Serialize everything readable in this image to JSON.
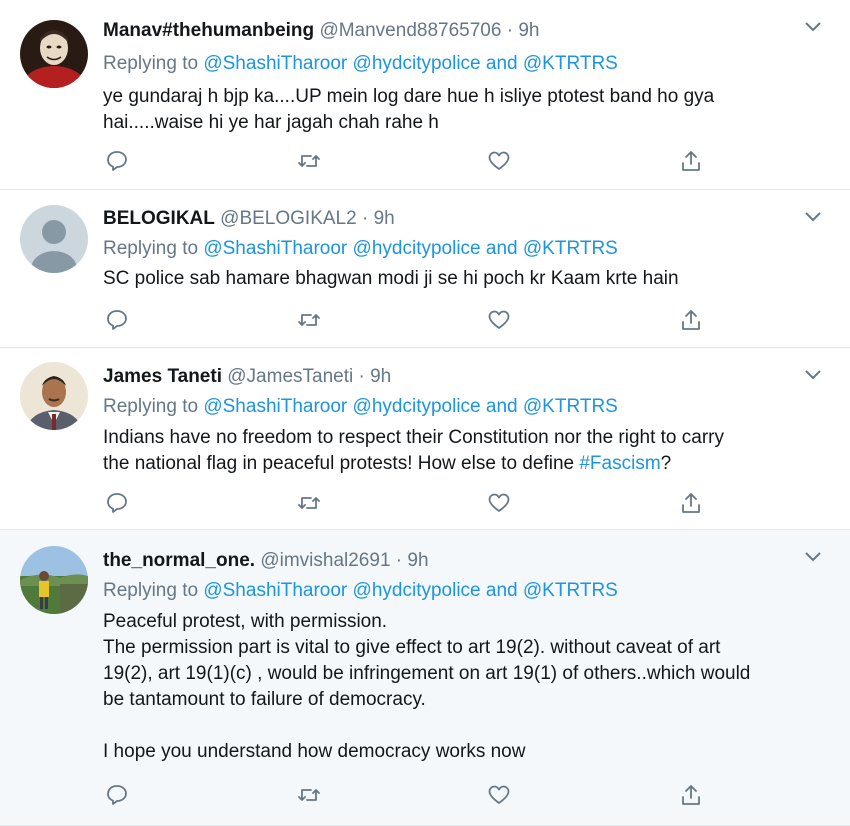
{
  "tweets": [
    {
      "name": "Manav#thehumanbeing",
      "handle": "@Manvend88765706",
      "sep": "·",
      "time": "9h",
      "replying_prefix": "Replying to",
      "mention1": "@ShashiTharoor",
      "mention2": "@hydcitypolice",
      "and": "and",
      "mention3": "@KTRTRS",
      "lines": [
        "ye gundaraj h bjp ka....UP mein log dare hue h isliye ptotest band ho gya",
        "hai.....waise hi ye har jagah chah rahe h"
      ],
      "avatar_icon": "masked-figure-avatar"
    },
    {
      "name": "BELOGIKAL",
      "handle": "@BELOGIKAL2",
      "sep": "·",
      "time": "9h",
      "replying_prefix": "Replying to",
      "mention1": "@ShashiTharoor",
      "mention2": "@hydcitypolice",
      "and": "and",
      "mention3": "@KTRTRS",
      "lines": [
        "SC police sab hamare bhagwan modi ji se hi poch kr Kaam krte hain"
      ],
      "avatar_icon": "default-user-avatar"
    },
    {
      "name": "James Taneti",
      "handle": "@JamesTaneti",
      "sep": "·",
      "time": "9h",
      "replying_prefix": "Replying to",
      "mention1": "@ShashiTharoor",
      "mention2": "@hydcitypolice",
      "and": "and",
      "mention3": "@KTRTRS",
      "lines": [
        "Indians have no freedom to respect their Constitution nor the right to carry",
        "the national flag in peaceful protests! How else to define "
      ],
      "hashtag": "#Fascism",
      "hashtag_suffix": "?",
      "avatar_icon": "man-portrait-avatar"
    },
    {
      "name": "the_normal_one.",
      "handle": "@imvishal2691",
      "sep": "·",
      "time": "9h",
      "replying_prefix": "Replying to",
      "mention1": "@ShashiTharoor",
      "mention2": "@hydcitypolice",
      "and": "and",
      "mention3": "@KTRTRS",
      "lines": [
        "Peaceful protest, with permission.",
        "The permission part is vital to give effect to art 19(2). without caveat of art",
        "19(2), art 19(1)(c) , would be infringement on art 19(1) of others..which would",
        "be tantamount to failure of democracy.",
        "",
        "I hope you understand how democracy works now"
      ],
      "avatar_icon": "outdoor-person-avatar"
    }
  ],
  "icons": {
    "reply": "reply-icon",
    "retweet": "retweet-icon",
    "like": "heart-icon",
    "share": "share-icon",
    "caret": "chevron-down-icon"
  },
  "colors": {
    "link": "#1b95e0",
    "secondary": "#657786",
    "divider": "#e1e8ed",
    "highlight_bg": "#f5f8fa"
  }
}
